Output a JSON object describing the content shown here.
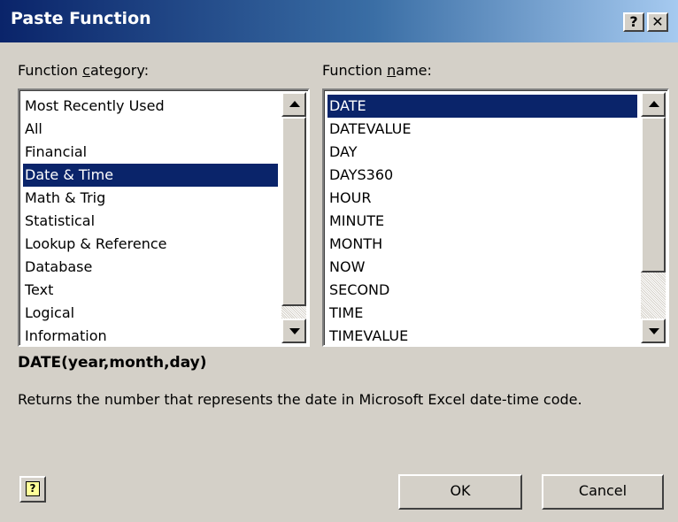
{
  "window": {
    "title": "Paste Function",
    "help_glyph": "?",
    "close_glyph": "✕"
  },
  "category": {
    "label_pre": "Function ",
    "label_key": "c",
    "label_post": "ategory:",
    "items": [
      "Most Recently Used",
      "All",
      "Financial",
      "Date & Time",
      "Math & Trig",
      "Statistical",
      "Lookup & Reference",
      "Database",
      "Text",
      "Logical",
      "Information"
    ],
    "selected": "Date & Time"
  },
  "function": {
    "label_pre": "Function ",
    "label_key": "n",
    "label_post": "ame:",
    "items": [
      "DATE",
      "DATEVALUE",
      "DAY",
      "DAYS360",
      "HOUR",
      "MINUTE",
      "MONTH",
      "NOW",
      "SECOND",
      "TIME",
      "TIMEVALUE"
    ],
    "selected": "DATE"
  },
  "syntax": "DATE(year,month,day)",
  "description": "Returns the number that represents the date in Microsoft Excel date-time code.",
  "buttons": {
    "ok": "OK",
    "cancel": "Cancel",
    "help_icon_glyph": "?"
  },
  "icons": {
    "help": "help-icon",
    "close": "close-icon",
    "scroll_up": "chevron-up-icon",
    "scroll_down": "chevron-down-icon",
    "assistant": "help-bubble-icon"
  },
  "colors": {
    "title_start": "#0a246a",
    "title_end": "#a6caf0",
    "selection": "#0a246a",
    "face": "#d4d0c8"
  }
}
